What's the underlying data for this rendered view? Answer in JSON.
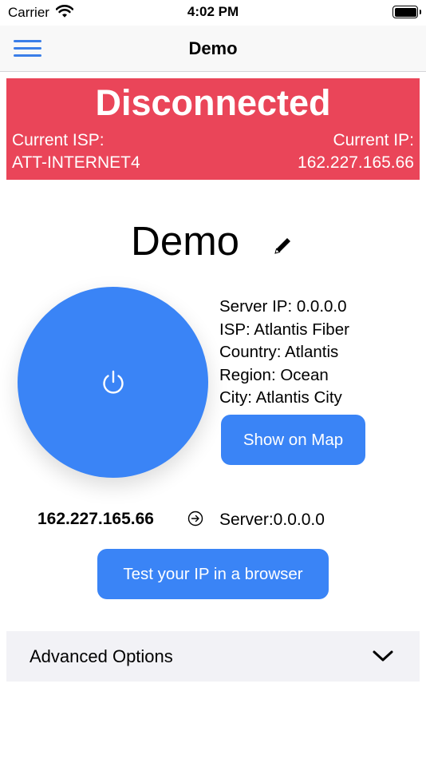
{
  "status_bar": {
    "carrier": "Carrier",
    "time": "4:02 PM"
  },
  "nav": {
    "title": "Demo"
  },
  "banner": {
    "status": "Disconnected",
    "isp_label": "Current ISP:",
    "isp_value": "ATT-INTERNET4",
    "ip_label": "Current IP:",
    "ip_value": "162.227.165.66"
  },
  "profile": {
    "name": "Demo"
  },
  "server": {
    "ip": "Server IP: 0.0.0.0",
    "isp": "ISP: Atlantis Fiber",
    "country": "Country: Atlantis",
    "region": "Region: Ocean",
    "city": "City: Atlantis City"
  },
  "buttons": {
    "show_map": "Show on Map",
    "test_ip": "Test your IP in a browser"
  },
  "route": {
    "current_ip": "162.227.165.66",
    "server": "Server:0.0.0.0"
  },
  "advanced": {
    "label": "Advanced Options"
  },
  "colors": {
    "accent": "#3a84f6",
    "disconnected": "#ea4559",
    "menu": "#3b7ee8",
    "panel": "#f2f2f6"
  },
  "icons": {
    "menu": "hamburger-icon",
    "edit": "pencil-icon",
    "power": "power-icon",
    "arrow": "arrow-right-circle-icon",
    "expand": "chevron-down-icon"
  }
}
